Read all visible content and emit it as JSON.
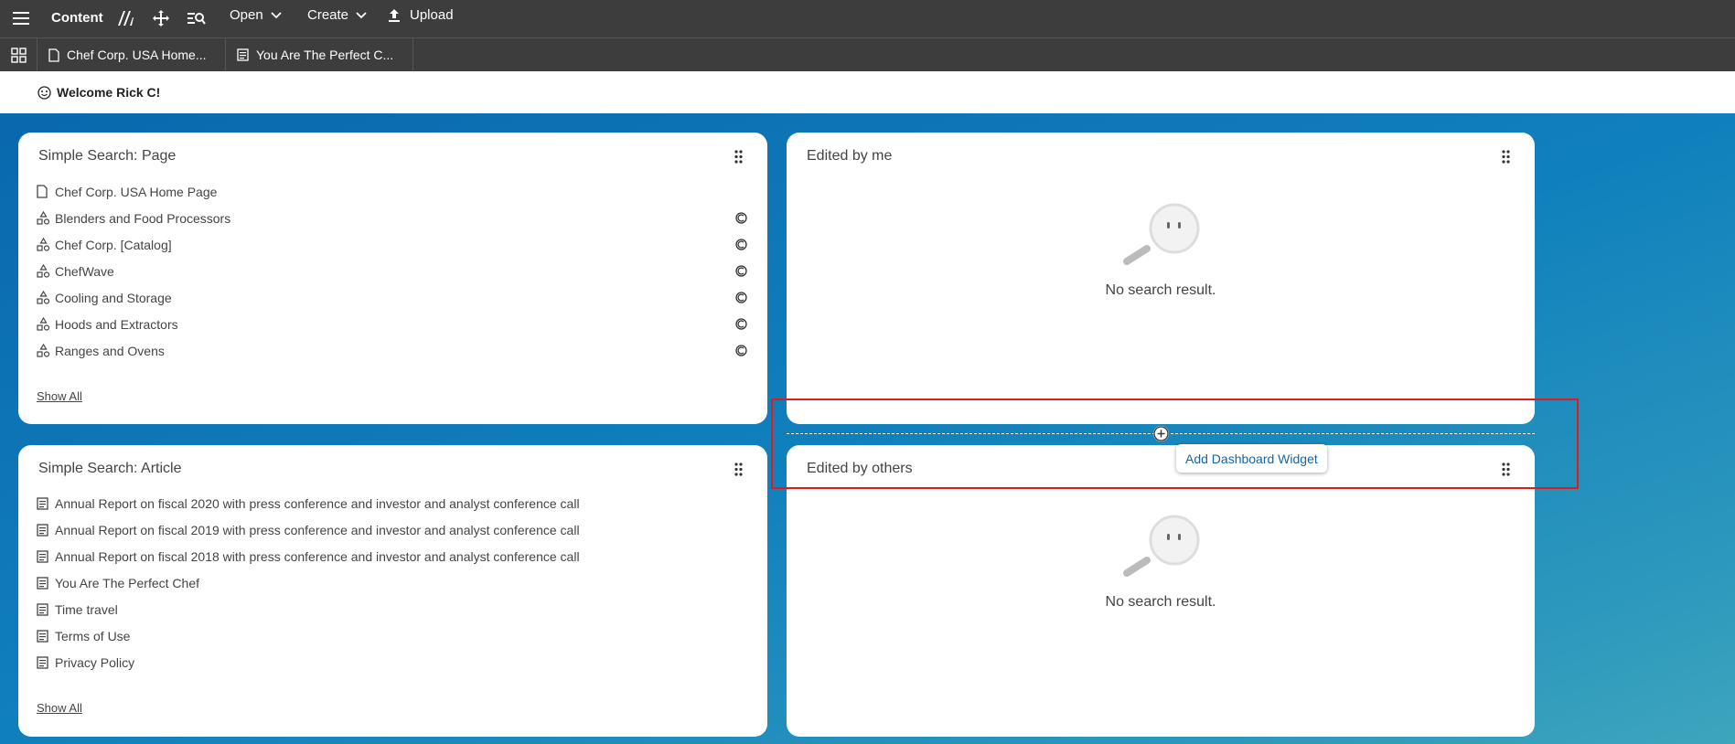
{
  "topbar": {
    "app_title": "Content",
    "open_label": "Open",
    "create_label": "Create",
    "upload_label": "Upload"
  },
  "tabs": [
    {
      "label": "Chef Corp. USA Home...",
      "icon": "page-icon"
    },
    {
      "label": "You Are The Perfect C...",
      "icon": "article-icon"
    }
  ],
  "welcome": {
    "text": "Welcome Rick C!"
  },
  "widgets": {
    "pages": {
      "title": "Simple Search: Page",
      "items": [
        {
          "label": "Chef Corp. USA Home Page",
          "icon": "page-icon",
          "status": false
        },
        {
          "label": "Blenders and Food Processors",
          "icon": "category-icon",
          "status": true
        },
        {
          "label": "Chef Corp. [Catalog]",
          "icon": "category-icon",
          "status": true
        },
        {
          "label": "ChefWave",
          "icon": "category-icon",
          "status": true
        },
        {
          "label": "Cooling and Storage",
          "icon": "category-icon",
          "status": true
        },
        {
          "label": "Hoods and Extractors",
          "icon": "category-icon",
          "status": true
        },
        {
          "label": "Ranges and Ovens",
          "icon": "category-icon",
          "status": true
        }
      ],
      "show_all": "Show All"
    },
    "articles": {
      "title": "Simple Search: Article",
      "items": [
        {
          "label": "Annual Report on fiscal 2020 with press conference and investor and analyst conference call",
          "icon": "article-icon"
        },
        {
          "label": "Annual Report on fiscal 2019 with press conference and investor and analyst conference call",
          "icon": "article-icon"
        },
        {
          "label": "Annual Report on fiscal 2018 with press conference and investor and analyst conference call",
          "icon": "article-icon"
        },
        {
          "label": "You Are The Perfect Chef",
          "icon": "article-icon"
        },
        {
          "label": "Time travel",
          "icon": "article-icon"
        },
        {
          "label": "Terms of Use",
          "icon": "article-icon"
        },
        {
          "label": "Privacy Policy",
          "icon": "article-icon"
        }
      ],
      "show_all": "Show All"
    },
    "edited_by_me": {
      "title": "Edited by me",
      "empty_text": "No search result."
    },
    "edited_by_others": {
      "title": "Edited by others",
      "empty_text": "No search result."
    }
  },
  "add_widget": {
    "label": "Add Dashboard Widget"
  },
  "colors": {
    "topbar": "#3d3d3d",
    "accent_link": "#1565a6",
    "highlight": "#e01b1b",
    "canvas": "#0f7cbb"
  }
}
